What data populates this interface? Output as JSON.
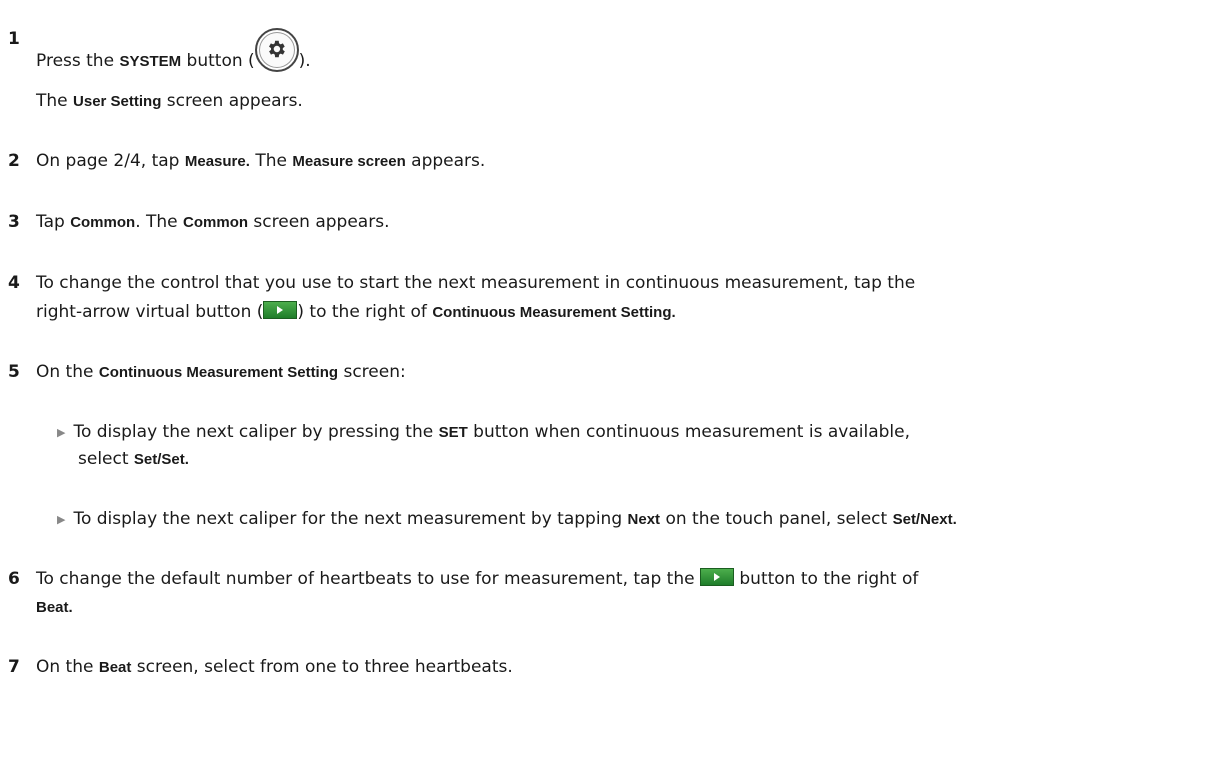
{
  "steps": {
    "s1": {
      "num": "1",
      "pre": "Press the ",
      "ui": "SYSTEM",
      "mid": " button (",
      "post": ")."
    },
    "s1_result": {
      "pre": "The ",
      "ui": "User Setting",
      "post": " screen appears."
    },
    "s2": {
      "num": "2",
      "pre": "On page 2/4, tap ",
      "ui1": "Measure.",
      "mid": " The ",
      "ui2": "Measure screen",
      "post": " appears."
    },
    "s3": {
      "num": "3",
      "pre": "Tap ",
      "ui1": "Common",
      "mid": ". The ",
      "ui2": "Common",
      "post": " screen appears."
    },
    "s4": {
      "num": "4",
      "line1": "To change the control that you use to start the next measurement in continuous measurement, tap the",
      "pre2": "right-arrow virtual button (",
      "mid2": ") to the right of ",
      "ui": "Continuous Measurement Setting",
      "post2": "."
    },
    "s5": {
      "num": "5",
      "pre": "On the ",
      "ui": "Continuous Measurement Setting",
      "post": " screen:"
    },
    "s5_b1": {
      "pre": "To display the next caliper by pressing the ",
      "ui": "SET",
      "post": " button when continuous measurement is available,",
      "cont_pre": "select ",
      "cont_ui": "Set/Set",
      "cont_post": "."
    },
    "s5_b2": {
      "pre": "To display the next caliper for the next measurement by tapping ",
      "ui1": "Next",
      "mid": " on the touch panel, select ",
      "ui2": "Set/Next",
      "post": "."
    },
    "s6": {
      "num": "6",
      "pre": "To change the default number of heartbeats to use for measurement, tap the ",
      "post": " button to the right of",
      "ui2": "Beat",
      "post2": "."
    },
    "s7": {
      "num": "7",
      "pre": "On the ",
      "ui": "Beat",
      "post": " screen, select from one to three heartbeats."
    }
  },
  "icons": {
    "system_button": "gear-icon",
    "arrow_button": "right-arrow-icon"
  }
}
